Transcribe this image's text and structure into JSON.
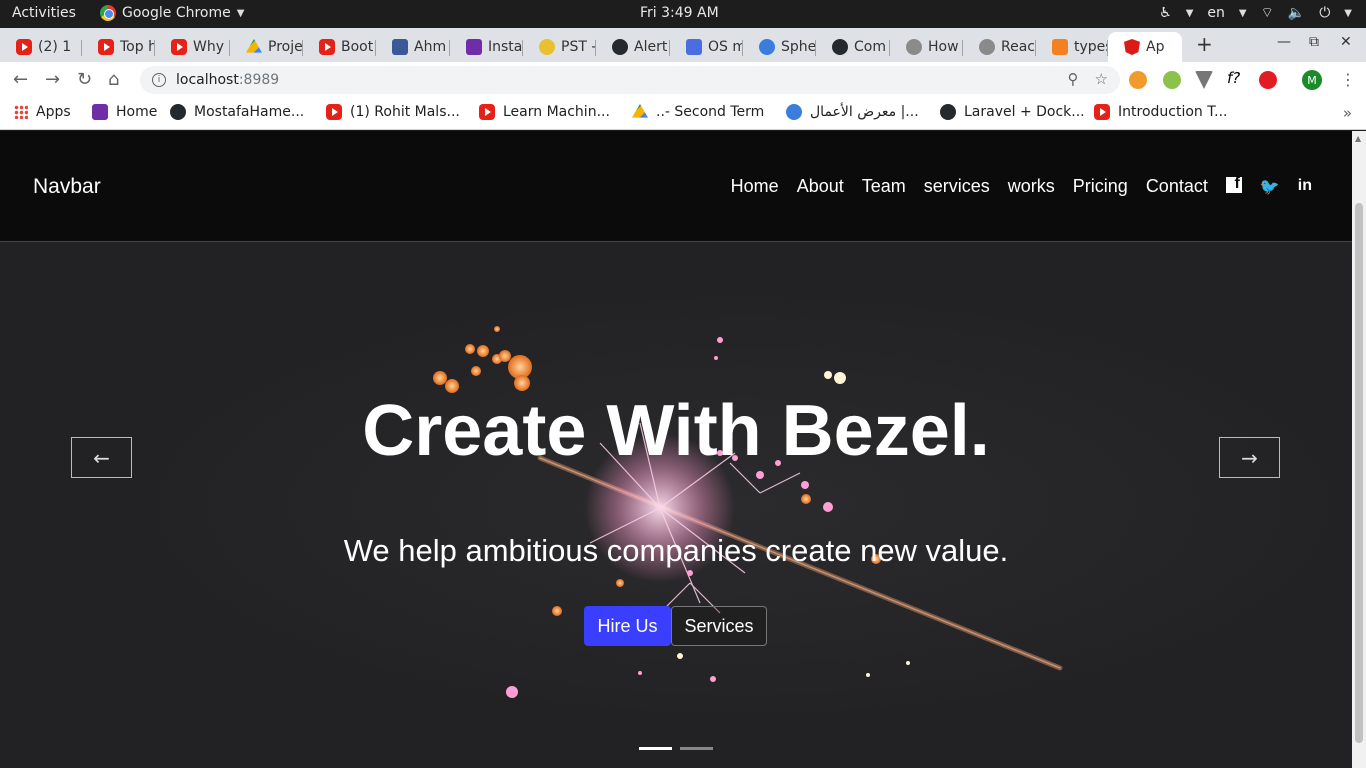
{
  "system_bar": {
    "activities": "Activities",
    "app_name": "Google Chrome",
    "clock": "Fri  3:49 AM",
    "language": "en"
  },
  "tabs": [
    {
      "label": "(2) 1",
      "icon": "youtube-icon"
    },
    {
      "label": "Top h",
      "icon": "youtube-icon"
    },
    {
      "label": "Why",
      "icon": "youtube-icon"
    },
    {
      "label": "Proje",
      "icon": "drive-icon"
    },
    {
      "label": "Boot",
      "icon": "youtube-icon"
    },
    {
      "label": "Ahm",
      "icon": "facebook-icon"
    },
    {
      "label": "Insta",
      "icon": "forms-icon"
    },
    {
      "label": "PST -",
      "icon": "emoji-icon"
    },
    {
      "label": "Alert",
      "icon": "github-icon"
    },
    {
      "label": "OS m",
      "icon": "docs-icon"
    },
    {
      "label": "Sphe",
      "icon": "sphere-icon"
    },
    {
      "label": "Com",
      "icon": "github-icon"
    },
    {
      "label": "How",
      "icon": "moz-icon"
    },
    {
      "label": "Reac",
      "icon": "moz-icon"
    },
    {
      "label": "types",
      "icon": "stackoverflow-icon"
    },
    {
      "label": "Ap",
      "icon": "angular-icon",
      "active": true
    }
  ],
  "address_bar": {
    "host": "localhost",
    "port": ":8989"
  },
  "bookmarks": [
    {
      "label": "Apps",
      "icon": "apps-grid-icon"
    },
    {
      "label": "Home",
      "icon": "bookmark-home-icon"
    },
    {
      "label": "MostafaHame...",
      "icon": "github-icon"
    },
    {
      "label": "(1) Rohit Mals...",
      "icon": "quora-icon"
    },
    {
      "label": "Learn Machin...",
      "icon": "youtube-icon"
    },
    {
      "label": "..- Second Term",
      "icon": "drive-icon"
    },
    {
      "label": "معرض الأعمال |...",
      "icon": "portfolio-icon"
    },
    {
      "label": "Laravel + Dock...",
      "icon": "medium-icon"
    },
    {
      "label": "Introduction T...",
      "icon": "udemy-icon"
    }
  ],
  "site": {
    "brand": "Navbar",
    "nav": [
      "Home",
      "About",
      "Team",
      "services",
      "works",
      "Pricing",
      "Contact"
    ],
    "social": [
      "facebook-icon",
      "twitter-icon",
      "linkedin-icon"
    ],
    "hero": {
      "title": "Create With Bezel.",
      "subtitle": "We help ambitious companies create new value.",
      "primary_button": "Hire Us",
      "secondary_button": "Services",
      "slide_count": 2,
      "active_slide": 0
    }
  },
  "colors": {
    "primary_button": "#3a3fff",
    "navbar_bg": "#0b0b0b",
    "hero_bg": "#222224"
  }
}
